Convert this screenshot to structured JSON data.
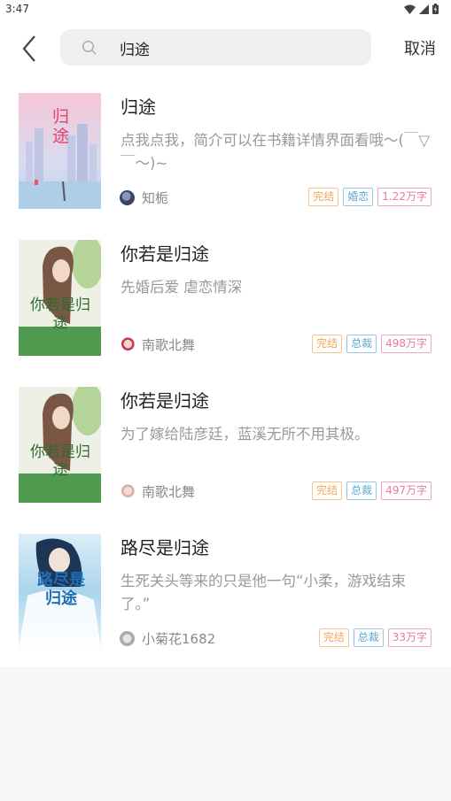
{
  "status_bar": {
    "time": "3:47"
  },
  "search": {
    "query": "归途",
    "cancel_label": "取消"
  },
  "results": [
    {
      "title": "归途",
      "description": "点我点我，简介可以在书籍详情界面看哦～(￣▽￣～)~",
      "author": "知栀",
      "status": "完结",
      "genre": "婚恋",
      "words": "1.22万字",
      "cover_text": "归途"
    },
    {
      "title": "你若是归途",
      "description": "先婚后爱 虐恋情深",
      "author": "南歌北舞",
      "status": "完结",
      "genre": "总裁",
      "words": "498万字",
      "cover_text": "你若是归途"
    },
    {
      "title": "你若是归途",
      "description": "为了嫁给陆彦廷，蓝溪无所不用其极。",
      "author": "南歌北舞",
      "status": "完结",
      "genre": "总裁",
      "words": "497万字",
      "cover_text": "你若是归途"
    },
    {
      "title": "路尽是归途",
      "description": "生死关头等来的只是他一句“小柔，游戏结束了。”",
      "author": "小菊花1682",
      "status": "完结",
      "genre": "总裁",
      "words": "33万字",
      "cover_text": "路尽是归途"
    }
  ]
}
